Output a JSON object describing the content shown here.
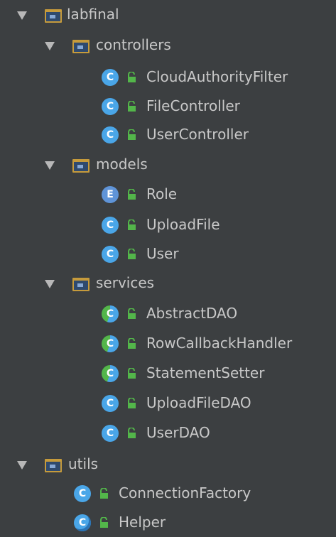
{
  "tree": {
    "root": {
      "label": "labfinal",
      "packages": [
        {
          "label": "controllers",
          "classes": [
            {
              "label": "CloudAuthorityFilter",
              "kind": "class",
              "icon": "class-icon"
            },
            {
              "label": "FileController",
              "kind": "class",
              "icon": "class-icon"
            },
            {
              "label": "UserController",
              "kind": "class",
              "icon": "class-icon"
            }
          ]
        },
        {
          "label": "models",
          "classes": [
            {
              "label": "Role",
              "kind": "enum",
              "icon": "enum-icon"
            },
            {
              "label": "UploadFile",
              "kind": "class",
              "icon": "class-icon"
            },
            {
              "label": "User",
              "kind": "class",
              "icon": "class-icon"
            }
          ]
        },
        {
          "label": "services",
          "classes": [
            {
              "label": "AbstractDAO",
              "kind": "abstract",
              "icon": "abstract-class-icon"
            },
            {
              "label": "RowCallbackHandler",
              "kind": "abstract",
              "icon": "abstract-class-icon"
            },
            {
              "label": "StatementSetter",
              "kind": "abstract",
              "icon": "abstract-class-icon"
            },
            {
              "label": "UploadFileDAO",
              "kind": "class",
              "icon": "class-icon"
            },
            {
              "label": "UserDAO",
              "kind": "class",
              "icon": "class-icon"
            }
          ]
        }
      ]
    },
    "utils": {
      "label": "utils",
      "classes": [
        {
          "label": "ConnectionFactory",
          "kind": "class",
          "icon": "class-icon"
        },
        {
          "label": "Helper",
          "kind": "special",
          "icon": "special-class-icon"
        }
      ]
    }
  },
  "badge_letters": {
    "class": "C",
    "enum": "E",
    "abstract": "C",
    "special": "C"
  },
  "colors": {
    "background": "#3c3f41",
    "text": "#c8c8c8",
    "folder": "#c69b3c",
    "class_badge": "#4aa6e8",
    "lock": "#53b64a"
  }
}
